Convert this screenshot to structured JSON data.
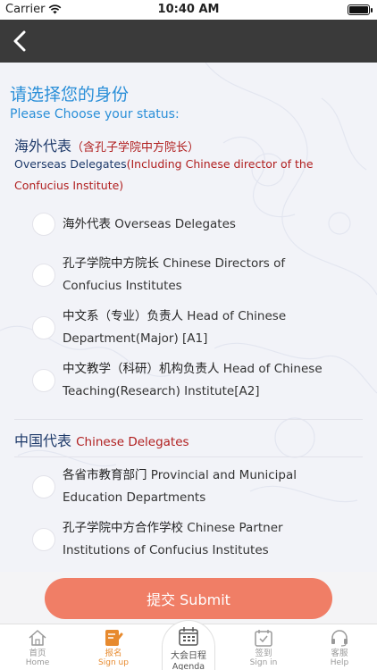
{
  "status_bar": {
    "carrier": "Carrier",
    "time": "10:40 AM"
  },
  "nav": {
    "back_icon": "chevron-left-icon"
  },
  "header": {
    "title_cn": "请选择您的身份",
    "title_en": "Please Choose your status:"
  },
  "overseas": {
    "title_cn": "海外代表",
    "title_note": "（含孔子学院中方院长）",
    "desc_en_a": "Overseas Delegates",
    "desc_en_b": "(Including Chinese director of the Confucius Institute)",
    "options": [
      {
        "cn": "海外代表",
        "en": "Overseas Delegates"
      },
      {
        "cn": "孔子学院中方院长",
        "en": "Chinese Directors of Confucius Institutes"
      },
      {
        "cn": "中文系（专业）负责人",
        "en": "Head of Chinese Department(Major) [A1]"
      },
      {
        "cn": "中文教学（科研）机构负责人",
        "en": "Head of Chinese Teaching(Research) Institute[A2]"
      }
    ]
  },
  "china": {
    "title_cn": "中国代表",
    "title_en": "Chinese Delegates",
    "options": [
      {
        "cn": "各省市教育部门",
        "en": "Provincial and Municipal Education Departments"
      },
      {
        "cn": "孔子学院中方合作学校",
        "en": "Chinese Partner Institutions of Confucius Institutes"
      }
    ]
  },
  "submit": {
    "label": "提交 Submit"
  },
  "tabs": {
    "home": {
      "cn": "首页",
      "en": "Home",
      "icon": "home-icon"
    },
    "signup": {
      "cn": "报名",
      "en": "Sign up",
      "icon": "edit-icon"
    },
    "agenda": {
      "cn": "大会日程",
      "en": "Agenda",
      "icon": "calendar-icon"
    },
    "signin": {
      "cn": "签到",
      "en": "Sign in",
      "icon": "checkin-icon"
    },
    "help": {
      "cn": "客服",
      "en": "Help",
      "icon": "headset-icon"
    }
  },
  "colors": {
    "accent_blue": "#2a8fd8",
    "navy": "#1e3a6a",
    "red": "#b01e1e",
    "submit": "#f07e66",
    "active_tab": "#e78a2e",
    "navbar": "#3a3a3a"
  }
}
